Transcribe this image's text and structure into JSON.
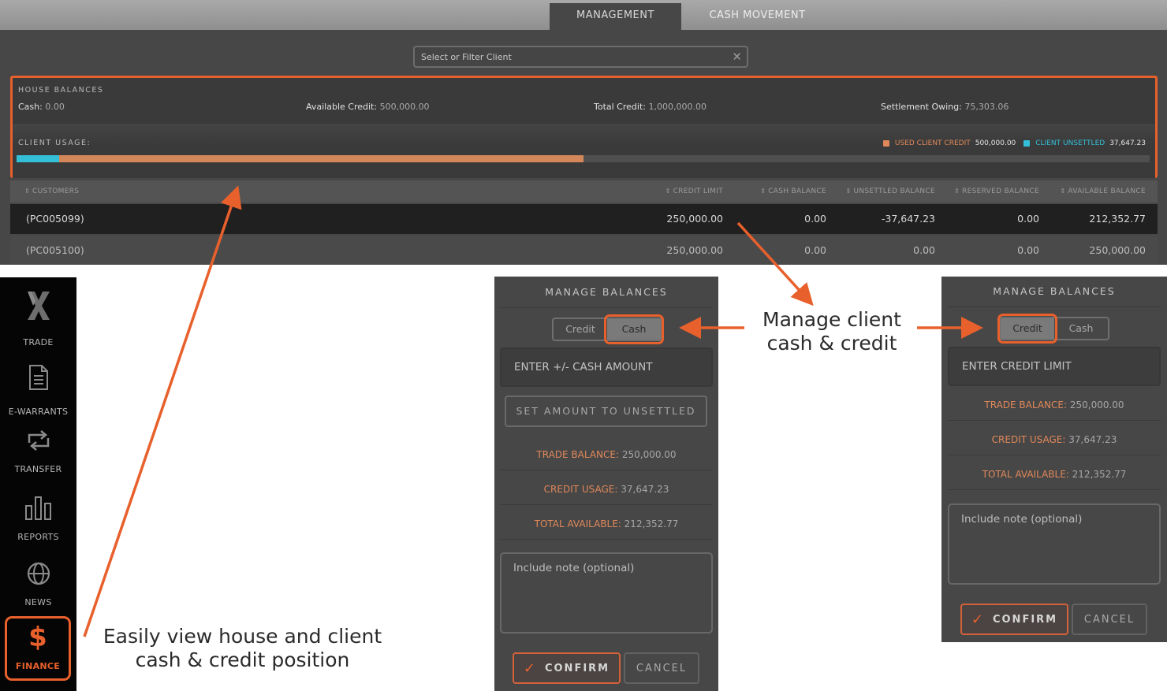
{
  "tabs": [
    {
      "label": "MANAGEMENT",
      "active": true
    },
    {
      "label": "CASH MOVEMENT",
      "active": false
    }
  ],
  "client_filter": {
    "placeholder": "Select or Filter Client",
    "value": "",
    "clear_icon": "close-icon"
  },
  "house_balances": {
    "title": "HOUSE BALANCES",
    "items": [
      {
        "label": "Cash:",
        "value": "0.00"
      },
      {
        "label": "Available Credit:",
        "value": "500,000.00"
      },
      {
        "label": "Total Credit:",
        "value": "1,000,000.00"
      },
      {
        "label": "Settlement Owing:",
        "value": "75,303.06"
      }
    ]
  },
  "client_usage": {
    "title": "CLIENT USAGE:",
    "legend": [
      {
        "label": "USED CLIENT CREDIT",
        "value": "500,000.00",
        "color": "#e0885a"
      },
      {
        "label": "CLIENT UNSETTLED",
        "value": "37,647.23",
        "color": "#34bfd8"
      }
    ],
    "total_capacity": 1000000,
    "unsettled_fraction": 0.0376,
    "used_credit_fraction": 0.5,
    "colors": {
      "unsettled": "#34bfd8",
      "used": "#d4885a",
      "track": "#4f4f4f"
    }
  },
  "table": {
    "columns": [
      "CUSTOMERS",
      "CREDIT LIMIT",
      "CASH BALANCE",
      "UNSETTLED BALANCE",
      "RESERVED BALANCE",
      "AVAILABLE BALANCE"
    ],
    "rows": [
      {
        "customer": "(PC005099)",
        "credit_limit": "250,000.00",
        "cash_balance": "0.00",
        "unsettled_balance": "-37,647.23",
        "reserved_balance": "0.00",
        "available_balance": "212,352.77",
        "selected": true
      },
      {
        "customer": "(PC005100)",
        "credit_limit": "250,000.00",
        "cash_balance": "0.00",
        "unsettled_balance": "0.00",
        "reserved_balance": "0.00",
        "available_balance": "250,000.00",
        "selected": false
      }
    ]
  },
  "sidebar": {
    "items": [
      {
        "label": "TRADE",
        "icon": "trade-logo-icon"
      },
      {
        "label": "E-WARRANTS",
        "icon": "document-icon"
      },
      {
        "label": "TRANSFER",
        "icon": "transfer-icon"
      },
      {
        "label": "REPORTS",
        "icon": "bar-chart-icon"
      },
      {
        "label": "NEWS",
        "icon": "globe-icon"
      },
      {
        "label": "FINANCE",
        "icon": "dollar-icon",
        "active": true
      }
    ]
  },
  "manage_cash": {
    "title": "MANAGE BALANCES",
    "segments": [
      "Credit",
      "Cash"
    ],
    "active_segment": "Cash",
    "amount_placeholder": "ENTER +/- CASH AMOUNT",
    "set_unsettled_label": "SET AMOUNT TO UNSETTLED",
    "stats": [
      {
        "label": "TRADE BALANCE:",
        "value": "250,000.00"
      },
      {
        "label": "CREDIT USAGE:",
        "value": "37,647.23"
      },
      {
        "label": "TOTAL AVAILABLE:",
        "value": "212,352.77"
      }
    ],
    "note_placeholder": "Include note (optional)",
    "confirm_label": "CONFIRM",
    "cancel_label": "CANCEL"
  },
  "manage_credit": {
    "title": "MANAGE BALANCES",
    "segments": [
      "Credit",
      "Cash"
    ],
    "active_segment": "Credit",
    "amount_placeholder": "ENTER CREDIT LIMIT",
    "stats": [
      {
        "label": "TRADE BALANCE:",
        "value": "250,000.00"
      },
      {
        "label": "CREDIT USAGE:",
        "value": "37,647.23"
      },
      {
        "label": "TOTAL AVAILABLE:",
        "value": "212,352.77"
      }
    ],
    "note_placeholder": "Include note (optional)",
    "confirm_label": "CONFIRM",
    "cancel_label": "CANCEL"
  },
  "annotations": {
    "manage": [
      "Manage client",
      "cash & credit"
    ],
    "view": [
      "Easily view house and client",
      "cash & credit position"
    ],
    "accent_color": "#e8602c"
  },
  "glyphs": {
    "sort": "⇕",
    "check": "✓",
    "close": "✕",
    "dollar": "$"
  }
}
